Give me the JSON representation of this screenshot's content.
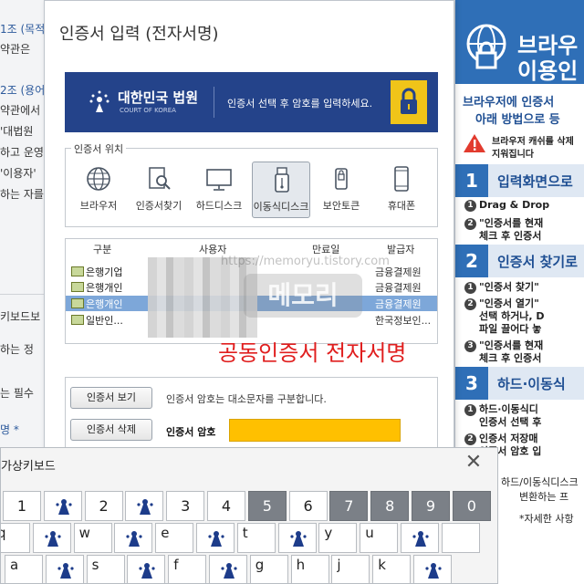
{
  "background_page": {
    "lines": [
      {
        "text": "1조 (목적",
        "style": "blue"
      },
      {
        "text": "약관은 ",
        "style": "dark"
      },
      {
        "text": "2조 (용어",
        "style": "blue"
      },
      {
        "text": "약관에서",
        "style": "dark"
      },
      {
        "text": "'대법원",
        "style": "dark"
      },
      {
        "text": "하고 운영",
        "style": "dark"
      },
      {
        "text": "'이용자'",
        "style": "dark"
      },
      {
        "text": "하는 자를",
        "style": "dark"
      },
      {
        "text": "키보드보",
        "style": "dark"
      },
      {
        "text": "하는 정",
        "style": "dark"
      },
      {
        "text": "는 필수",
        "style": "dark"
      },
      {
        "text": "명 *",
        "style": "blue"
      }
    ]
  },
  "dialog": {
    "title": "인증서 입력 (전자서명)",
    "banner": {
      "logo_ko": "대한민국 법원",
      "logo_en": "COURT OF KOREA",
      "message": "인증서 선택 후 암호를 입력하세요."
    },
    "location": {
      "legend": "인증서 위치",
      "items": [
        {
          "label": "브라우저",
          "icon": "globe-icon",
          "selected": false
        },
        {
          "label": "인증서찾기",
          "icon": "cert-search-icon",
          "selected": false
        },
        {
          "label": "하드디스크",
          "icon": "monitor-icon",
          "selected": false
        },
        {
          "label": "이동식디스크",
          "icon": "usb-icon",
          "selected": true
        },
        {
          "label": "보안토큰",
          "icon": "token-icon",
          "selected": false
        },
        {
          "label": "휴대폰",
          "icon": "phone-icon",
          "selected": false
        }
      ]
    },
    "table": {
      "headers": {
        "type": "구분",
        "user": "사용자",
        "expiry": "만료일",
        "issuer": "발급자"
      },
      "rows": [
        {
          "type": "은행기업",
          "issuer": "금융결제원",
          "selected": false
        },
        {
          "type": "은행개인",
          "issuer": "금융결제원",
          "selected": false
        },
        {
          "type": "은행개인",
          "issuer": "금융결제원",
          "selected": true
        },
        {
          "type": "일반인...",
          "issuer": "한국정보인...",
          "selected": false
        }
      ],
      "watermark_url": "https://memoryu.tistory.com",
      "watermark_logo": "메모리"
    },
    "caption": "공동인증서 전자서명",
    "view_button": "인증서 보기",
    "delete_button": "인증서 삭제",
    "case_note": "인증서 암호는 대소문자를 구분합니다.",
    "password_label": "인증서 암호"
  },
  "help_panel": {
    "header_line1": "브라우",
    "header_line2": "이용인",
    "intro1": "브라우저에 인증서",
    "intro2": "아래 방법으로 등",
    "warn1": "브라우저 캐쉬를 삭제",
    "warn2": "지워집니다",
    "sections": [
      {
        "num": "1",
        "title": "입력화면으로"
      },
      {
        "num": "2",
        "title": "인증서 찾기로"
      },
      {
        "num": "3",
        "title": "하드·이동식"
      }
    ],
    "lines": [
      {
        "text": "Drag & Drop",
        "circle": "1"
      },
      {
        "text": "\"인증서를 현재",
        "circle": "2"
      },
      {
        "text": "체크 후 인증서",
        "circle": ""
      },
      {
        "text": "\"인증서 찾기\"",
        "circle": "1"
      },
      {
        "text": "\"인증서 열기\"",
        "circle": "2"
      },
      {
        "text": "선택 하거나, D",
        "circle": ""
      },
      {
        "text": "파일 끌어다 놓",
        "circle": ""
      },
      {
        "text": "\"인증서를 현재",
        "circle": "3"
      },
      {
        "text": "체크 후 인증서",
        "circle": ""
      },
      {
        "text": "하드·이동식디",
        "circle": "1"
      },
      {
        "text": "인증서 선택 후",
        "circle": ""
      },
      {
        "text": "인증서 저장매",
        "circle": "2"
      },
      {
        "text": "인증서 암호 입",
        "circle": ""
      },
      {
        "text": "하드/이동식디스크",
        "circle": ""
      },
      {
        "text": "변환하는 프",
        "circle": ""
      },
      {
        "text": "*자세한 사항",
        "circle": ""
      }
    ]
  },
  "keyboard": {
    "title": "가상키보드",
    "close": "✕",
    "row1": [
      {
        "label": "1",
        "type": "char"
      },
      {
        "label": "",
        "type": "fig"
      },
      {
        "label": "2",
        "type": "char"
      },
      {
        "label": "",
        "type": "fig"
      },
      {
        "label": "3",
        "type": "char"
      },
      {
        "label": "4",
        "type": "char"
      },
      {
        "label": "5",
        "type": "dark"
      },
      {
        "label": "6",
        "type": "char"
      },
      {
        "label": "7",
        "type": "dark"
      },
      {
        "label": "8",
        "type": "dark"
      },
      {
        "label": "9",
        "type": "dark"
      },
      {
        "label": "0",
        "type": "dark"
      }
    ],
    "row2": [
      {
        "label": "q",
        "type": "char"
      },
      {
        "label": "",
        "type": "fig"
      },
      {
        "label": "w",
        "type": "char"
      },
      {
        "label": "",
        "type": "fig"
      },
      {
        "label": "e",
        "type": "char"
      },
      {
        "label": "",
        "type": "fig"
      },
      {
        "label": "t",
        "type": "char"
      },
      {
        "label": "",
        "type": "fig"
      },
      {
        "label": "y",
        "type": "char"
      },
      {
        "label": "u",
        "type": "char"
      },
      {
        "label": "",
        "type": "fig"
      },
      {
        "label": "",
        "type": "char"
      }
    ],
    "row3": [
      {
        "label": "a",
        "type": "char"
      },
      {
        "label": "",
        "type": "fig"
      },
      {
        "label": "s",
        "type": "char"
      },
      {
        "label": "",
        "type": "fig"
      },
      {
        "label": "f",
        "type": "char"
      },
      {
        "label": "",
        "type": "fig"
      },
      {
        "label": "g",
        "type": "char"
      },
      {
        "label": "h",
        "type": "char"
      },
      {
        "label": "j",
        "type": "char"
      },
      {
        "label": "k",
        "type": "char"
      },
      {
        "label": "",
        "type": "fig"
      }
    ]
  },
  "colors": {
    "banner_bg": "#24438a",
    "help_blue": "#2f6fb7",
    "password_fill": "#ffc000",
    "caption_red": "#e01e1e",
    "selected_row": "#7da7d9"
  }
}
